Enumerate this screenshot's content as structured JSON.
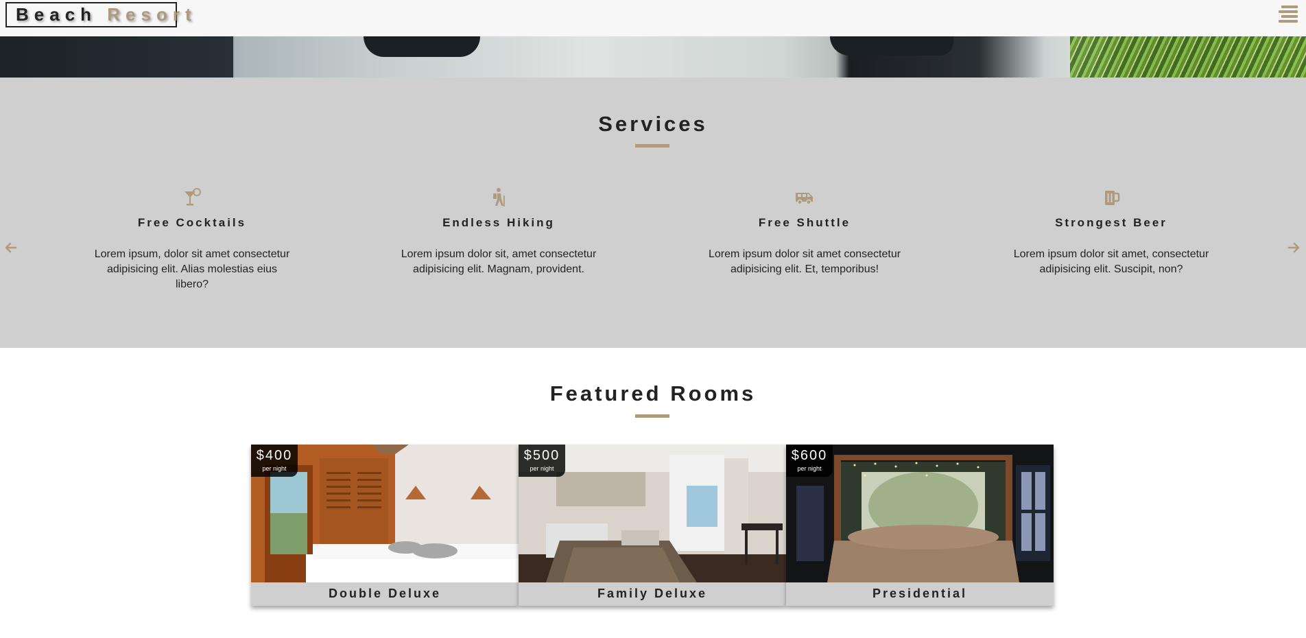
{
  "navbar": {
    "logo_word1": "Beach",
    "logo_word2": "Resort",
    "menu_icon": "menu-lines-icon"
  },
  "colors": {
    "accent": "#af9a7d",
    "services_bg": "#cfcfcf",
    "navbar_bg": "#f7f7f7",
    "text": "#222222"
  },
  "services": {
    "title": "Services",
    "prev_icon": "arrow-left-icon",
    "next_icon": "arrow-right-icon",
    "items": [
      {
        "icon": "cocktail-icon",
        "title": "Free Cocktails",
        "text": "Lorem ipsum, dolor sit amet consectetur adipisicing elit. Alias molestias eius libero?"
      },
      {
        "icon": "hiking-icon",
        "title": "Endless Hiking",
        "text": "Lorem ipsum dolor sit, amet consectetur adipisicing elit. Magnam, provident."
      },
      {
        "icon": "shuttle-van-icon",
        "title": "Free Shuttle",
        "text": "Lorem ipsum dolor sit amet consectetur adipisicing elit. Et, temporibus!"
      },
      {
        "icon": "beer-mug-icon",
        "title": "Strongest Beer",
        "text": "Lorem ipsum dolor sit amet, consectetur adipisicing elit. Suscipit, non?"
      }
    ]
  },
  "featured": {
    "title": "Featured Rooms",
    "rooms": [
      {
        "name": "Double Deluxe",
        "price": "$400",
        "per": "per night"
      },
      {
        "name": "Family Deluxe",
        "price": "$500",
        "per": "per night"
      },
      {
        "name": "Presidential",
        "price": "$600",
        "per": "per night"
      }
    ]
  }
}
